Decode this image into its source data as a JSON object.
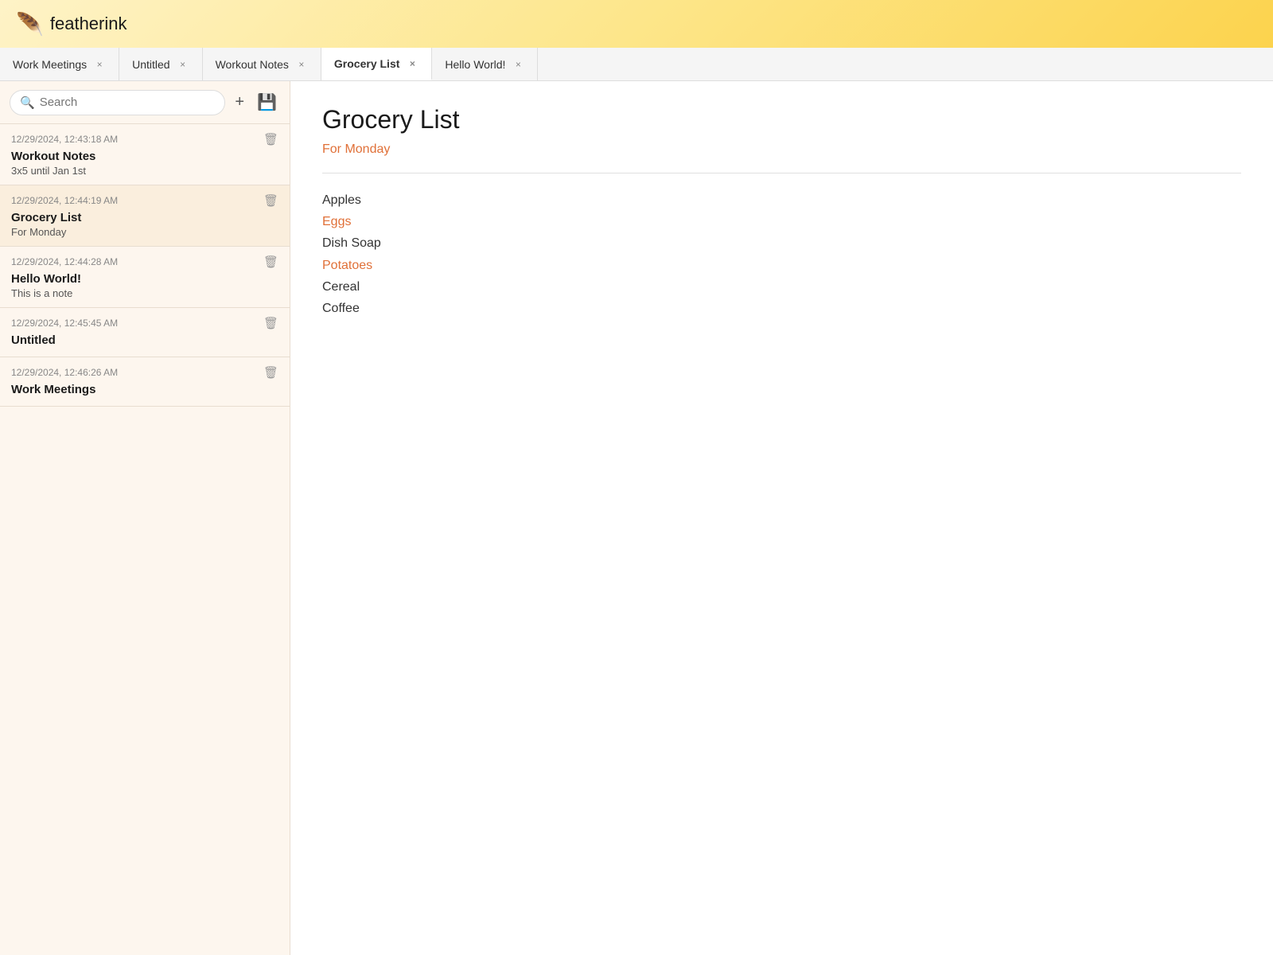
{
  "app": {
    "name": "featherink",
    "logo_icon": "🪶"
  },
  "header": {
    "title": "featherink"
  },
  "search": {
    "placeholder": "Search",
    "value": ""
  },
  "toolbar": {
    "new_label": "+",
    "save_label": "💾"
  },
  "tabs": [
    {
      "id": "work-meetings",
      "label": "Work Meetings",
      "active": false
    },
    {
      "id": "untitled",
      "label": "Untitled",
      "active": false
    },
    {
      "id": "workout-notes",
      "label": "Workout Notes",
      "active": false
    },
    {
      "id": "grocery-list",
      "label": "Grocery List",
      "active": true
    },
    {
      "id": "hello-world",
      "label": "Hello World!",
      "active": false
    }
  ],
  "notes": [
    {
      "id": "workout-notes",
      "timestamp": "12/29/2024, 12:43:18 AM",
      "title": "Workout Notes",
      "preview": "3x5 until Jan 1st",
      "active": false
    },
    {
      "id": "grocery-list",
      "timestamp": "12/29/2024, 12:44:19 AM",
      "title": "Grocery List",
      "preview": "For Monday",
      "active": true
    },
    {
      "id": "hello-world",
      "timestamp": "12/29/2024, 12:44:28 AM",
      "title": "Hello World!",
      "preview": "This is a note",
      "active": false
    },
    {
      "id": "untitled",
      "timestamp": "12/29/2024, 12:45:45 AM",
      "title": "Untitled",
      "preview": "",
      "active": false
    },
    {
      "id": "work-meetings",
      "timestamp": "12/29/2024, 12:46:26 AM",
      "title": "Work Meetings",
      "preview": "",
      "active": false
    }
  ],
  "editor": {
    "title": "Grocery List",
    "subtitle": "For Monday",
    "body_lines": [
      {
        "text": "Apples",
        "colored": false
      },
      {
        "text": "Eggs",
        "colored": true
      },
      {
        "text": "Dish Soap",
        "colored": false
      },
      {
        "text": "Potatoes",
        "colored": true
      },
      {
        "text": "Cereal",
        "colored": false
      },
      {
        "text": "Coffee",
        "colored": false
      },
      {
        "text": "|",
        "colored": false,
        "cursor": true
      }
    ]
  }
}
